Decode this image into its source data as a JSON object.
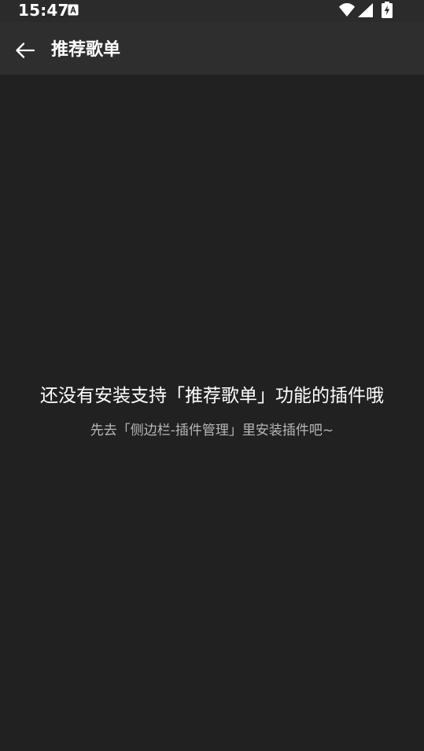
{
  "status_bar": {
    "time": "15:47",
    "icons": [
      "a-notification-icon",
      "wifi-icon",
      "signal-icon",
      "battery-charging-icon"
    ]
  },
  "app_bar": {
    "title": "推荐歌单",
    "back_icon": "arrow-left-icon"
  },
  "empty_state": {
    "title": "还没有安装支持「推荐歌单」功能的插件哦",
    "subtitle": "先去「侧边栏-插件管理」里安装插件吧~"
  },
  "colors": {
    "background": "#212121",
    "app_bar": "#2e2e2e",
    "status_bar": "#2b2b2b",
    "primary_text": "#ffffff",
    "secondary_text": "#b8b8b8"
  }
}
